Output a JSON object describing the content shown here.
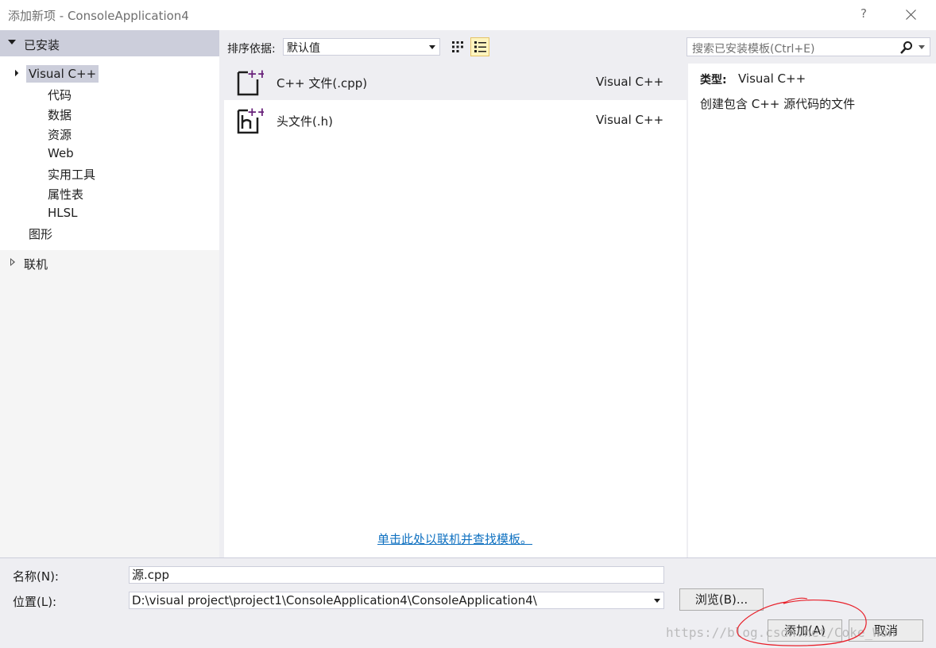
{
  "window": {
    "title": "添加新项 - ConsoleApplication4",
    "help_label": "?"
  },
  "sidebar": {
    "header": "已安装",
    "items": [
      {
        "label": "Visual C++"
      },
      {
        "label": "代码"
      },
      {
        "label": "数据"
      },
      {
        "label": "资源"
      },
      {
        "label": "Web"
      },
      {
        "label": "实用工具"
      },
      {
        "label": "属性表"
      },
      {
        "label": "HLSL"
      },
      {
        "label": "图形"
      }
    ],
    "online": "联机"
  },
  "toolbar": {
    "sort_label": "排序依据:",
    "sort_value": "默认值",
    "search_placeholder": "搜索已安装模板(Ctrl+E)"
  },
  "templates": [
    {
      "name": "C++ 文件(.cpp)",
      "lang": "Visual C++",
      "icon": "cpp-file-icon"
    },
    {
      "name": "头文件(.h)",
      "lang": "Visual C++",
      "icon": "header-file-icon"
    }
  ],
  "online_link": "单击此处以联机并查找模板。",
  "detail": {
    "type_key": "类型:",
    "type_value": "Visual C++",
    "description": "创建包含 C++ 源代码的文件"
  },
  "form": {
    "name_label": "名称(N):",
    "name_value": "源.cpp",
    "location_label": "位置(L):",
    "location_value": "D:\\visual project\\project1\\ConsoleApplication4\\ConsoleApplication4\\",
    "browse_label": "浏览(B)...",
    "add_label": "添加(A)",
    "cancel_label": "取消"
  },
  "watermark": "https://blog.csdn.net/Coke_Won",
  "colors": {
    "accent_selection": "#cccedb",
    "link": "#0e70c0",
    "icon_purple": "#68217a",
    "annotation_red": "#e8202a"
  }
}
